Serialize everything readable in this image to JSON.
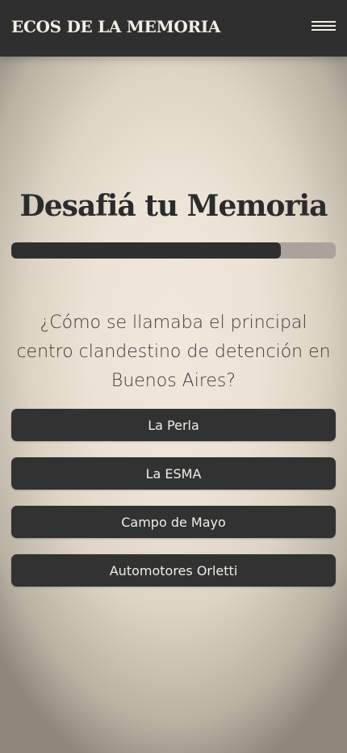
{
  "header": {
    "brand": "ECOS DE LA MEMORIA",
    "menu_icon": "hamburger-menu-icon"
  },
  "quiz": {
    "title": "Desafiá tu Memoria",
    "progress": 0.83,
    "question": "¿Cómo se llamaba el principal centro clandestino de detención en Buenos Aires?",
    "options": [
      {
        "label": "La Perla"
      },
      {
        "label": "La ESMA"
      },
      {
        "label": "Campo de Mayo"
      },
      {
        "label": "Automotores Orletti"
      }
    ]
  },
  "colors": {
    "header_bg": "#2f2f2f",
    "button_bg": "#323232",
    "progress_track": "#a9a39b",
    "progress_fill": "#2f2f2f",
    "background_center": "#f1e8dc"
  }
}
